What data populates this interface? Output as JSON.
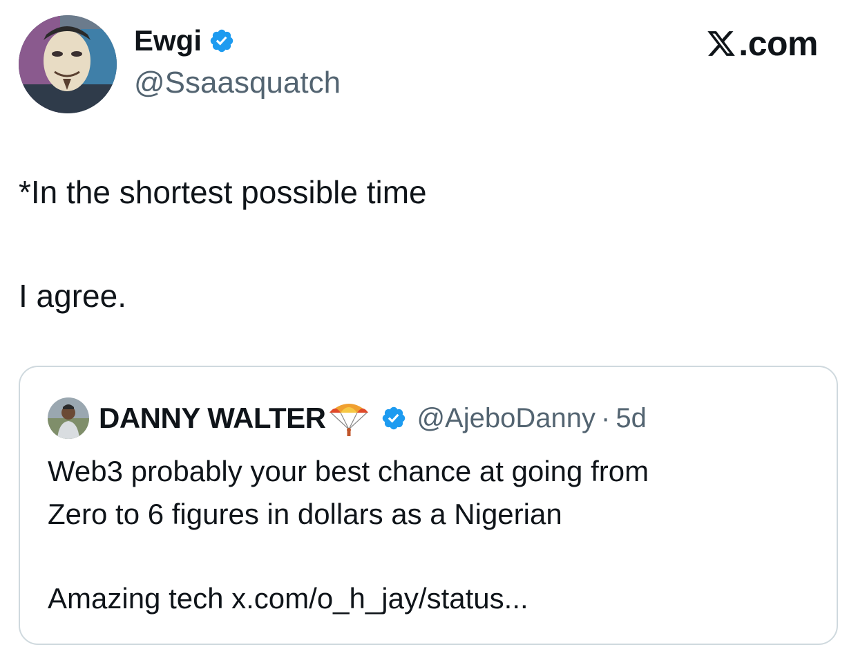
{
  "author": {
    "name": "Ewgi",
    "handle": "@Ssaasquatch"
  },
  "brand": {
    "text": ".com",
    "logo_icon": "x-logo-icon"
  },
  "tweet": {
    "lines": [
      "*In the shortest possible time",
      "I agree."
    ]
  },
  "quoted": {
    "name": "DANNY WALTER",
    "emoji": "parachute-emoji",
    "handle": "@AjeboDanny",
    "separator": "·",
    "time": "5d",
    "lines": [
      "Web3 probably your best chance at going from",
      "Zero to 6 figures in dollars as a Nigerian",
      "Amazing tech x.com/o_h_jay/status..."
    ]
  },
  "colors": {
    "text": "#0f1419",
    "secondary": "#536471",
    "verified": "#1d9bf0",
    "border": "#cfd9de"
  }
}
